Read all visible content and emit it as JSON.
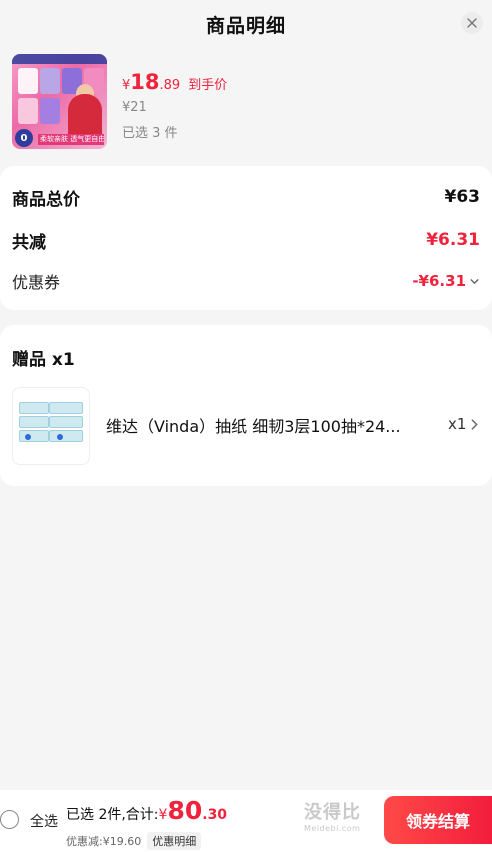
{
  "header": {
    "title": "商品明细",
    "close_icon": "close-icon"
  },
  "product": {
    "currency": "¥",
    "price_int": "18",
    "price_dec": ".89",
    "price_tag": "到手价",
    "original_price": "¥21",
    "selected": "已选 3 件",
    "thumb_badge": "0",
    "thumb_banner": "柔软亲肤 透气更自由"
  },
  "summary": {
    "total_label": "商品总价",
    "total_value": "¥63",
    "reduce_label": "共减",
    "reduce_value": "¥6.31",
    "coupon_label": "优惠券",
    "coupon_value": "-¥6.31"
  },
  "gift": {
    "title": "赠品 x1",
    "item_name": "维达（Vinda）抽纸 细韧3层100抽*24...",
    "item_qty": "x1"
  },
  "bottom": {
    "select_all": "全选",
    "total_prefix": "已选 2件,合计:",
    "currency": "¥",
    "total_int": "80",
    "total_dec": ".30",
    "discount": "优惠减:¥19.60",
    "detail_label": "优惠明细",
    "watermark_big": "没得比",
    "watermark_small": "Meidebi.com",
    "checkout_label": "领券结算"
  },
  "colors": {
    "accent": "#f0233c",
    "background": "#f5f5f5"
  }
}
